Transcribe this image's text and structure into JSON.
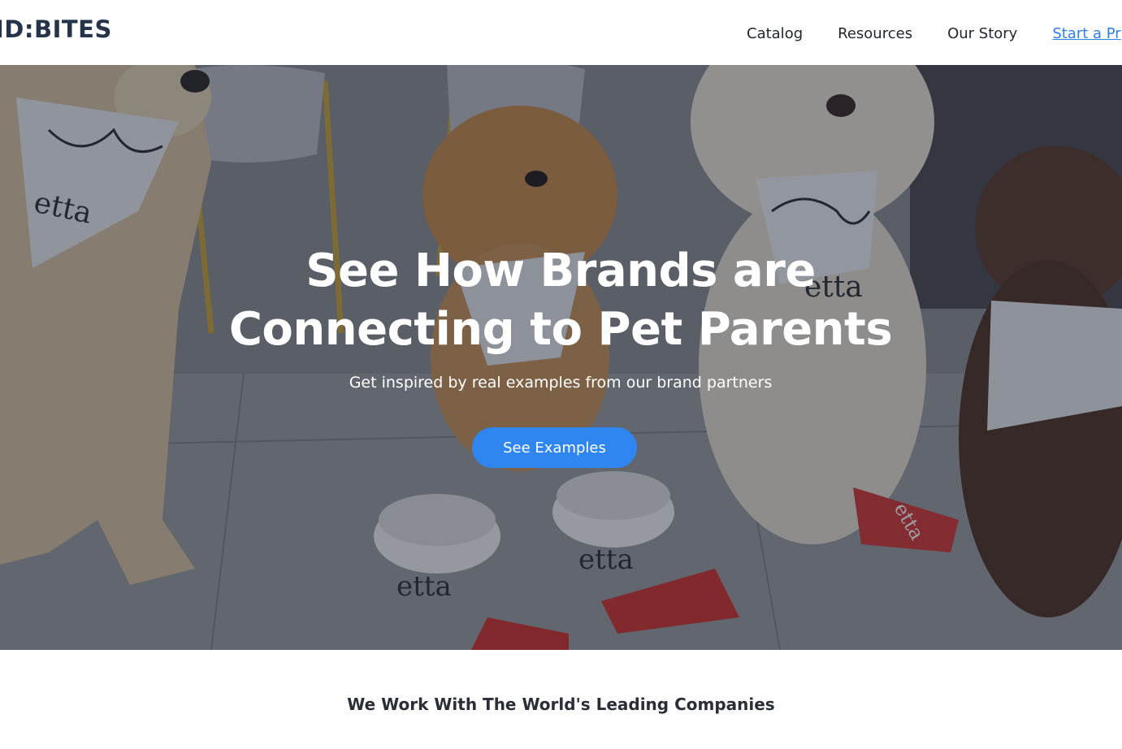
{
  "header": {
    "logo_text": "ID:BITES",
    "nav": [
      {
        "label": "Catalog"
      },
      {
        "label": "Resources"
      },
      {
        "label": "Our Story"
      }
    ],
    "cta_label": "Start a Pr"
  },
  "hero": {
    "title_line1": "See How Brands are",
    "title_line2": "Connecting to Pet Parents",
    "subtitle": "Get inspired by real examples from our brand partners",
    "button_label": "See Examples",
    "image_texts": {
      "bandana": "etta",
      "bowl": "etta",
      "toy": "etta"
    }
  },
  "companies_heading": "We Work With The World's Leading Companies",
  "colors": {
    "brand_navy": "#253449",
    "accent_blue": "#2f86f0",
    "link_blue": "#2f7fe5",
    "nav_text": "#23272f"
  }
}
